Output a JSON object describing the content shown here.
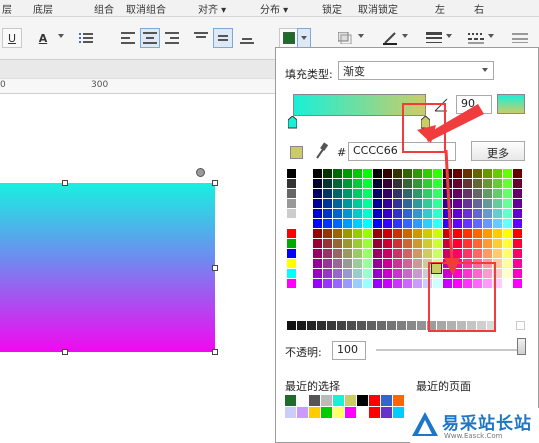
{
  "toolbar_top": {
    "items": [
      "层",
      "底层",
      "组合",
      "取消组合",
      "对齐",
      "分布",
      "锁定",
      "取消锁定",
      "左",
      "右"
    ]
  },
  "toolbar": {
    "underline_label": "U",
    "font_color_label": "A"
  },
  "ruler": {
    "ticks": [
      "0",
      "300"
    ]
  },
  "panel": {
    "fill_type_label": "填充类型:",
    "fill_type_value": "渐变",
    "angle_value": "90",
    "hash_label": "#",
    "hex_value": "CCCC66",
    "more_button": "更多",
    "opacity_label": "不透明:",
    "opacity_value": "100",
    "recent_colors_label": "最近的选择",
    "recent_pages_label": "最近的页面"
  },
  "colors": {
    "gradient_start": "#18f0d8",
    "gradient_end": "#cccc66",
    "selected": "#cccc66",
    "shape_top": "#18f0e0",
    "shape_bottom": "#f208f0",
    "annotation": "#f03c3c"
  },
  "icons": [
    "fill-color-icon",
    "eyedropper-icon",
    "line-color-icon",
    "border-style-icon",
    "alignment-icon"
  ],
  "watermark": {
    "logo_text": "易采站长站",
    "url_text": "Www.Easck.Com"
  }
}
